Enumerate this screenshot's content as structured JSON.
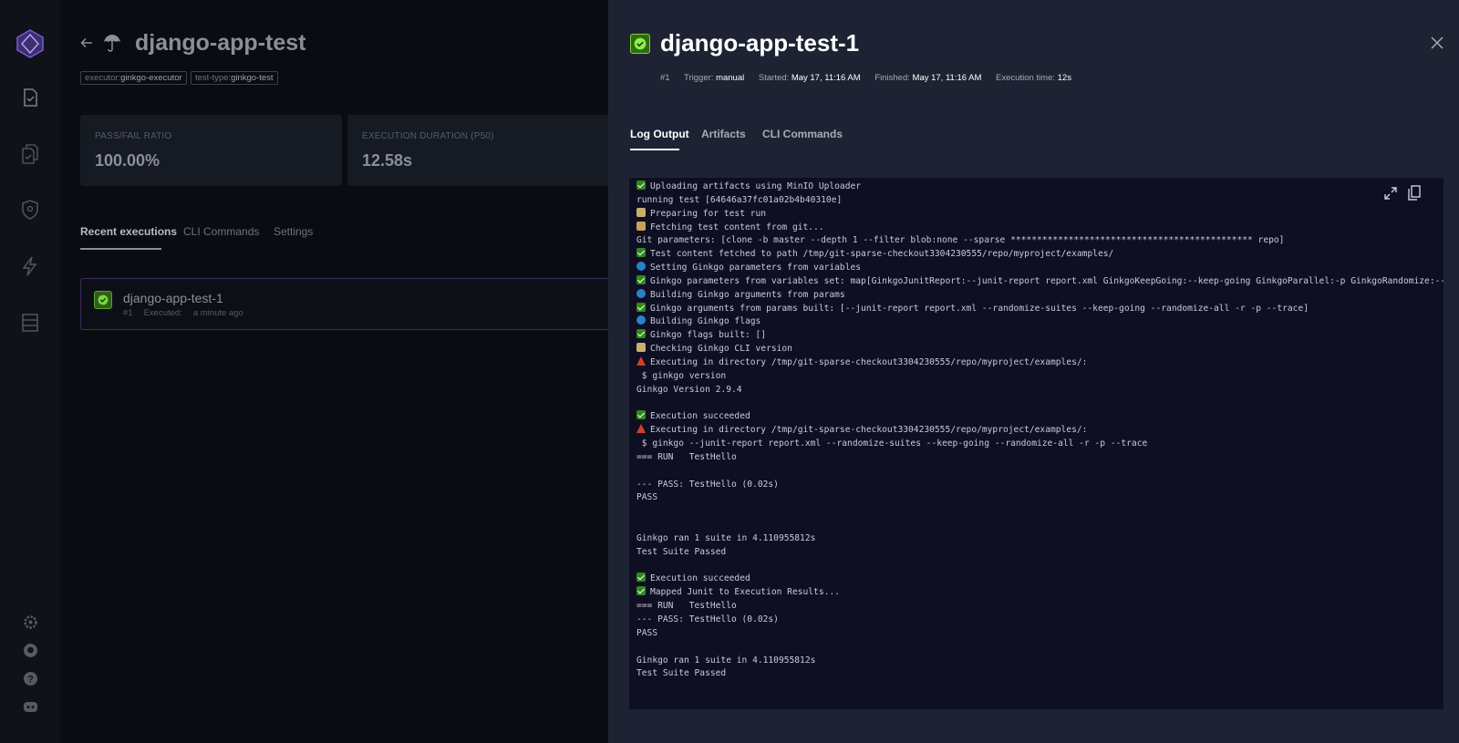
{
  "sidebar": {
    "nav_items": [
      "tests-icon",
      "test-suites-icon",
      "executors-icon",
      "triggers-icon",
      "sources-icon"
    ],
    "footer_items": [
      "settings-icon",
      "github-icon",
      "help-icon",
      "discord-icon"
    ]
  },
  "main": {
    "title": "django-app-test",
    "tags": [
      {
        "key": "executor:",
        "value": "ginkgo-executor"
      },
      {
        "key": "test-type:",
        "value": "ginkgo-test"
      }
    ],
    "metrics": [
      {
        "label": "PASS/FAIL RATIO",
        "value": "100.00%"
      },
      {
        "label": "EXECUTION DURATION (P50)",
        "value": "12.58s"
      }
    ],
    "tabs": [
      {
        "label": "Recent executions",
        "active": true
      },
      {
        "label": "CLI Commands",
        "active": false
      },
      {
        "label": "Settings",
        "active": false
      }
    ],
    "executions": [
      {
        "name": "django-app-test-1",
        "number": "#1",
        "executed_label": "Executed:",
        "executed_value": "a minute ago",
        "status": "passed"
      }
    ]
  },
  "panel": {
    "title": "django-app-test-1",
    "status": "passed",
    "meta": {
      "number": "#1",
      "trigger_label": "Trigger:",
      "trigger_value": "manual",
      "started_label": "Started:",
      "started_value": "May 17, 11:16 AM",
      "finished_label": "Finished:",
      "finished_value": "May 17, 11:16 AM",
      "exec_time_label": "Execution time:",
      "exec_time_value": "12s"
    },
    "tabs": [
      {
        "label": "Log Output",
        "active": true
      },
      {
        "label": "Artifacts",
        "active": false
      },
      {
        "label": "CLI Commands",
        "active": false
      }
    ],
    "log_lines": [
      {
        "icon": "check",
        "text": "Uploading artifacts using MinIO Uploader"
      },
      {
        "icon": "",
        "text": "running test [64646a37fc01a02b4b40310e]"
      },
      {
        "icon": "truck",
        "text": "Preparing for test run"
      },
      {
        "icon": "box",
        "text": "Fetching test content from git..."
      },
      {
        "icon": "",
        "text": "Git parameters: [clone -b master --depth 1 --filter blob:none --sparse ********************************************** repo]"
      },
      {
        "icon": "check",
        "text": "Test content fetched to path /tmp/git-sparse-checkout3304230555/repo/myproject/examples/"
      },
      {
        "icon": "globe",
        "text": "Setting Ginkgo parameters from variables"
      },
      {
        "icon": "check",
        "text": "Ginkgo parameters from variables set: map[GinkgoJunitReport:--junit-report report.xml GinkgoKeepGoing:--keep-going GinkgoParallel:-p GinkgoRandomize:--ran"
      },
      {
        "icon": "globe",
        "text": "Building Ginkgo arguments from params"
      },
      {
        "icon": "check",
        "text": "Ginkgo arguments from params built: [--junit-report report.xml --randomize-suites --keep-going --randomize-all -r -p --trace]"
      },
      {
        "icon": "globe",
        "text": "Building Ginkgo flags"
      },
      {
        "icon": "check",
        "text": "Ginkgo flags built: []"
      },
      {
        "icon": "truck",
        "text": "Checking Ginkgo CLI version"
      },
      {
        "icon": "flask",
        "text": "Executing in directory /tmp/git-sparse-checkout3304230555/repo/myproject/examples/:"
      },
      {
        "icon": "",
        "text": " $ ginkgo version"
      },
      {
        "icon": "",
        "text": "Ginkgo Version 2.9.4"
      },
      {
        "icon": "",
        "text": ""
      },
      {
        "icon": "check",
        "text": "Execution succeeded"
      },
      {
        "icon": "flask",
        "text": "Executing in directory /tmp/git-sparse-checkout3304230555/repo/myproject/examples/:"
      },
      {
        "icon": "",
        "text": " $ ginkgo --junit-report report.xml --randomize-suites --keep-going --randomize-all -r -p --trace"
      },
      {
        "icon": "",
        "text": "=== RUN   TestHello"
      },
      {
        "icon": "",
        "text": ""
      },
      {
        "icon": "",
        "text": "--- PASS: TestHello (0.02s)"
      },
      {
        "icon": "",
        "text": "PASS"
      },
      {
        "icon": "",
        "text": ""
      },
      {
        "icon": "",
        "text": ""
      },
      {
        "icon": "",
        "text": "Ginkgo ran 1 suite in 4.110955812s"
      },
      {
        "icon": "",
        "text": "Test Suite Passed"
      },
      {
        "icon": "",
        "text": ""
      },
      {
        "icon": "check",
        "text": "Execution succeeded"
      },
      {
        "icon": "check",
        "text": "Mapped Junit to Execution Results..."
      },
      {
        "icon": "",
        "text": "=== RUN   TestHello"
      },
      {
        "icon": "",
        "text": "--- PASS: TestHello (0.02s)"
      },
      {
        "icon": "",
        "text": "PASS"
      },
      {
        "icon": "",
        "text": ""
      },
      {
        "icon": "",
        "text": "Ginkgo ran 1 suite in 4.110955812s"
      },
      {
        "icon": "",
        "text": "Test Suite Passed"
      }
    ]
  }
}
